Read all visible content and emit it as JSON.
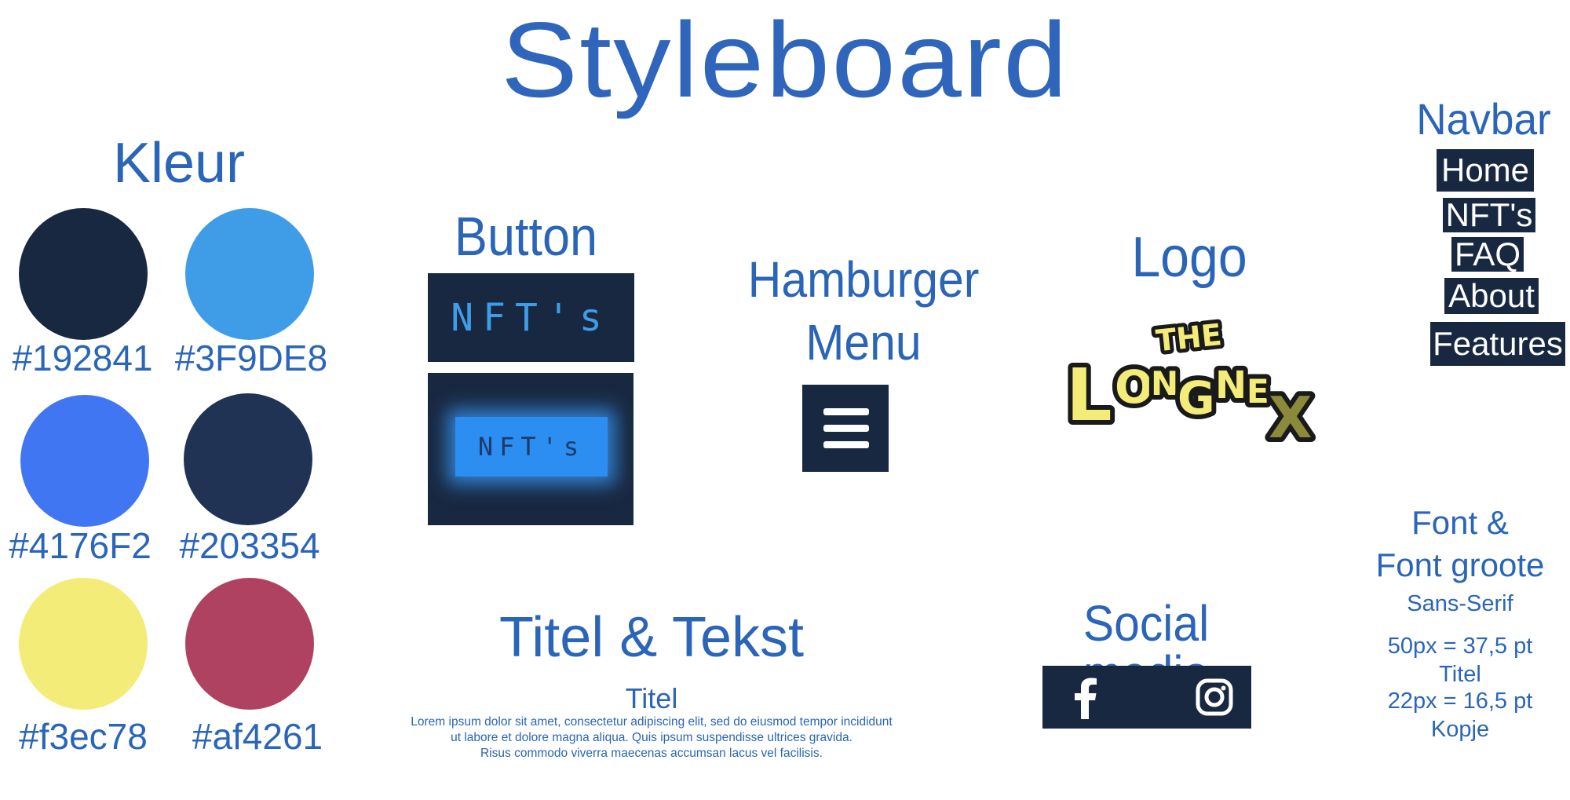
{
  "title": "Styleboard",
  "colors": {
    "heading": "Kleur",
    "swatches": [
      {
        "hex": "#192841",
        "label": "#192841"
      },
      {
        "hex": "#3F9DE8",
        "label": "#3F9DE8"
      },
      {
        "hex": "#4176F2",
        "label": "#4176F2"
      },
      {
        "hex": "#203354",
        "label": "#203354"
      },
      {
        "hex": "#f3ec78",
        "label": "#f3ec78"
      },
      {
        "hex": "#af4261",
        "label": "#af4261"
      }
    ]
  },
  "button": {
    "heading": "Button",
    "normal_label": "NFT's",
    "hover_label": "NFT's"
  },
  "hamburger": {
    "heading_line1": "Hamburger",
    "heading_line2": "Menu",
    "icon": "hamburger-icon"
  },
  "logo": {
    "heading": "Logo",
    "text_the": "THE",
    "text_main": "LONGNEX"
  },
  "navbar": {
    "heading": "Navbar",
    "items": [
      "Home",
      "NFT's",
      "FAQ",
      "About",
      "Features"
    ]
  },
  "title_text": {
    "heading": "Titel & Tekst",
    "sample_title": "Titel",
    "lorem_line1": "Lorem ipsum dolor sit amet, consectetur adipiscing elit, sed do eiusmod tempor incididunt",
    "lorem_line2": "ut labore et dolore magna aliqua. Quis ipsum suspendisse ultrices gravida.",
    "lorem_line3": "Risus commodo viverra maecenas accumsan lacus vel facilisis."
  },
  "social": {
    "heading": "Social media",
    "icons": [
      "facebook-icon",
      "instagram-icon"
    ]
  },
  "font": {
    "heading_line1": "Font &",
    "heading_line2": "Font groote",
    "family": "Sans-Serif",
    "size1": "50px = 37,5 pt",
    "size1_use": "Titel",
    "size2": "22px = 16,5 pt",
    "size2_use": "Kopje"
  },
  "accent_colors": {
    "text": "#2a65b8",
    "dark": "#192841",
    "glow": "#3F9DE8"
  }
}
